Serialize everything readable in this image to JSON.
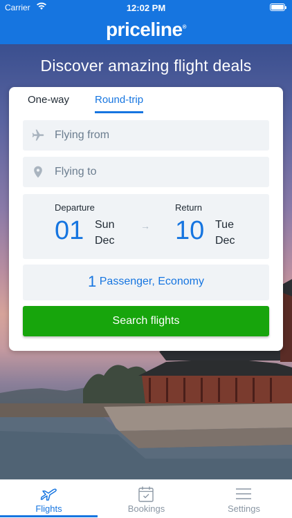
{
  "status": {
    "carrier": "Carrier",
    "time": "12:02 PM"
  },
  "header": {
    "brand": "priceline"
  },
  "tagline": "Discover amazing flight deals",
  "trip_tabs": [
    {
      "label": "One-way",
      "active": false
    },
    {
      "label": "Round-trip",
      "active": true
    }
  ],
  "from_field": {
    "placeholder": "Flying from",
    "icon": "plane-icon"
  },
  "to_field": {
    "placeholder": "Flying to",
    "icon": "location-pin-icon"
  },
  "departure": {
    "label": "Departure",
    "day": "01",
    "weekday": "Sun",
    "month": "Dec"
  },
  "return": {
    "label": "Return",
    "day": "10",
    "weekday": "Tue",
    "month": "Dec"
  },
  "passengers": {
    "count": "1",
    "description": "Passenger, Economy"
  },
  "search_button": "Search flights",
  "tabbar": [
    {
      "label": "Flights",
      "icon": "plane-icon",
      "active": true
    },
    {
      "label": "Bookings",
      "icon": "calendar-check-icon",
      "active": false
    },
    {
      "label": "Settings",
      "icon": "menu-icon",
      "active": false
    }
  ],
  "colors": {
    "brand": "#1675e0",
    "search": "#17a50c",
    "field_bg": "#f0f3f6"
  }
}
